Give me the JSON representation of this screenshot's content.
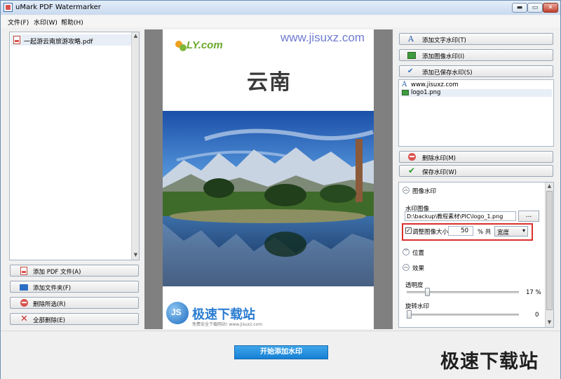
{
  "window": {
    "title": "uMark PDF Watermarker",
    "min_label": "▬",
    "max_label": "▭",
    "close_label": "✕"
  },
  "menu": {
    "items": [
      {
        "label": "文件(F)"
      },
      {
        "label": "水印(W)"
      },
      {
        "label": "帮助(H)"
      }
    ]
  },
  "file_list": {
    "items": [
      {
        "name": "一起游云南旅游攻略.pdf"
      }
    ]
  },
  "left_buttons": {
    "add_pdf": "添加 PDF 文件(A)",
    "add_folder": "添加文件夹(F)",
    "delete_selected": "删除所选(R)",
    "delete_all": "全部删除(E)"
  },
  "preview": {
    "header_watermark": "www.jisuxz.com",
    "logo_text": "LY.com",
    "page_title": "云南",
    "footer_brand": "极速下载站",
    "footer_sub": "免费安全下载网站!  www.jisuxz.com"
  },
  "right_buttons": {
    "add_text": "添加文字水印(T)",
    "add_image": "添加图像水印(I)",
    "add_saved": "添加已保存水印(S)",
    "delete_wm": "删除水印(M)",
    "save_wm": "保存水印(W)"
  },
  "watermark_list": {
    "items": [
      {
        "icon": "A",
        "label": "www.jisuxz.com"
      },
      {
        "icon": "image",
        "label": "logo1.png"
      }
    ]
  },
  "image_section": {
    "title": "图像水印",
    "image_label": "水印图像",
    "image_path": "D:\\backup\\教程素材\\PIC\\logo_1.png",
    "browse_label": "...",
    "resize_label": "调整图像大小",
    "resize_checked": true,
    "resize_value": "50",
    "percent_of": "% 共",
    "dimension": "宽度",
    "dimension_arrow": "▾"
  },
  "position_section": {
    "title": "位置"
  },
  "effect_section": {
    "title": "效果",
    "opacity_label": "透明度",
    "opacity_value": "17 %",
    "opacity_fraction": 0.17,
    "rotate_label": "旋转水印",
    "rotate_value": "0",
    "rotate_fraction": 0.0
  },
  "start_button": "开始添加水印",
  "corner_watermark": "极速下载站",
  "colors": {
    "accent": "#1680d4",
    "highlight_box": "#d9302c"
  }
}
